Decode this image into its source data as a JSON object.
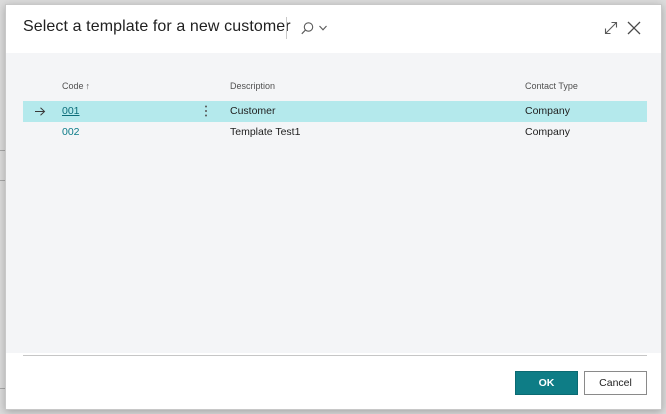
{
  "dialog": {
    "title": "Select a template for a new customer"
  },
  "columns": {
    "code": "Code",
    "code_sort": "↑",
    "description": "Description",
    "contact_type": "Contact Type"
  },
  "rows": [
    {
      "code": "001",
      "description": "Customer",
      "contact_type": "Company",
      "selected": true
    },
    {
      "code": "002",
      "description": "Template Test1",
      "contact_type": "Company",
      "selected": false
    }
  ],
  "buttons": {
    "ok": "OK",
    "cancel": "Cancel"
  },
  "icons": {
    "search": "search-icon",
    "chevron": "chevron-down-icon",
    "expand": "expand-icon",
    "close": "close-icon",
    "row_arrow": "arrow-right-icon",
    "more": "vertical-ellipsis-icon"
  },
  "colors": {
    "accent": "#0e7d86",
    "selected_row": "#b4e9ec",
    "link": "#0b7b88"
  }
}
